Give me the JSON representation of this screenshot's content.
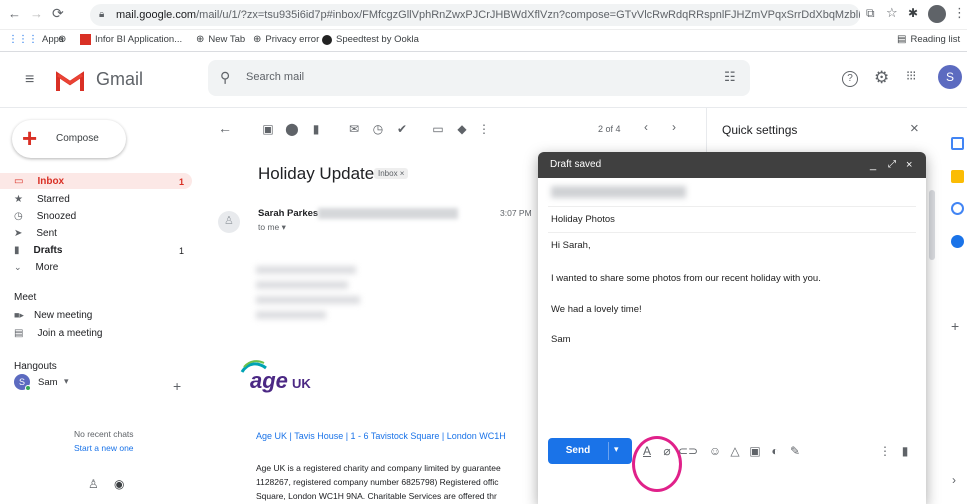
{
  "browser": {
    "url_host": "mail.google.com",
    "url_path": "/mail/u/1/?zx=tsu935i6id7p#inbox/FMfcgzGllVphRnZwxPJCrJHBWdXflVzn?compose=GTvVlcRwRdqRRspnlFJHZmVPqxSrrDdXbqMzblLTQG...",
    "bookmarks": [
      "Apps",
      "Infor BI Application...",
      "New Tab",
      "Privacy error",
      "Speedtest by Ookla"
    ],
    "reading_list": "Reading list"
  },
  "gmail": {
    "logo_text": "Gmail",
    "search_placeholder": "Search mail",
    "avatar_letter": "S",
    "compose_label": "Compose"
  },
  "sidebar": {
    "items": [
      {
        "label": "Inbox",
        "count": "1"
      },
      {
        "label": "Starred",
        "count": ""
      },
      {
        "label": "Snoozed",
        "count": ""
      },
      {
        "label": "Sent",
        "count": ""
      },
      {
        "label": "Drafts",
        "count": "1"
      },
      {
        "label": "More",
        "count": ""
      }
    ],
    "meet_heading": "Meet",
    "meet_items": [
      "New meeting",
      "Join a meeting"
    ],
    "hangouts_heading": "Hangouts",
    "hangouts_user": "Sam",
    "no_chats": "No recent chats",
    "start_chat": "Start a new one"
  },
  "message": {
    "pagination": "2 of 4",
    "subject": "Holiday Update",
    "label_badge": "Inbox",
    "sender": "Sarah Parkes",
    "to_me": "to me",
    "time": "3:07 PM",
    "logo_text": "age",
    "logo_suffix": "UK",
    "address": "Age UK | Tavis House | 1 - 6 Tavistock Square | London WC1H",
    "footer_lines": [
      "Age UK is a registered charity and company limited by guarantee",
      "1128267, registered company number 6825798) Registered offic",
      "Square, London WC1H 9NA. Charitable Services are offered thr"
    ]
  },
  "quick_settings": {
    "title": "Quick settings"
  },
  "compose": {
    "title": "Draft saved",
    "subject": "Holiday Photos",
    "body": [
      "Hi Sarah,",
      "I wanted to share some photos from our recent holiday with you.",
      "We had a lovely time!",
      "Sam"
    ],
    "send_label": "Send"
  },
  "colors": {
    "gmail_red": "#d93025",
    "send_blue": "#1a73e8",
    "annotation_magenta": "#e0218a",
    "compose_header": "#404040"
  }
}
